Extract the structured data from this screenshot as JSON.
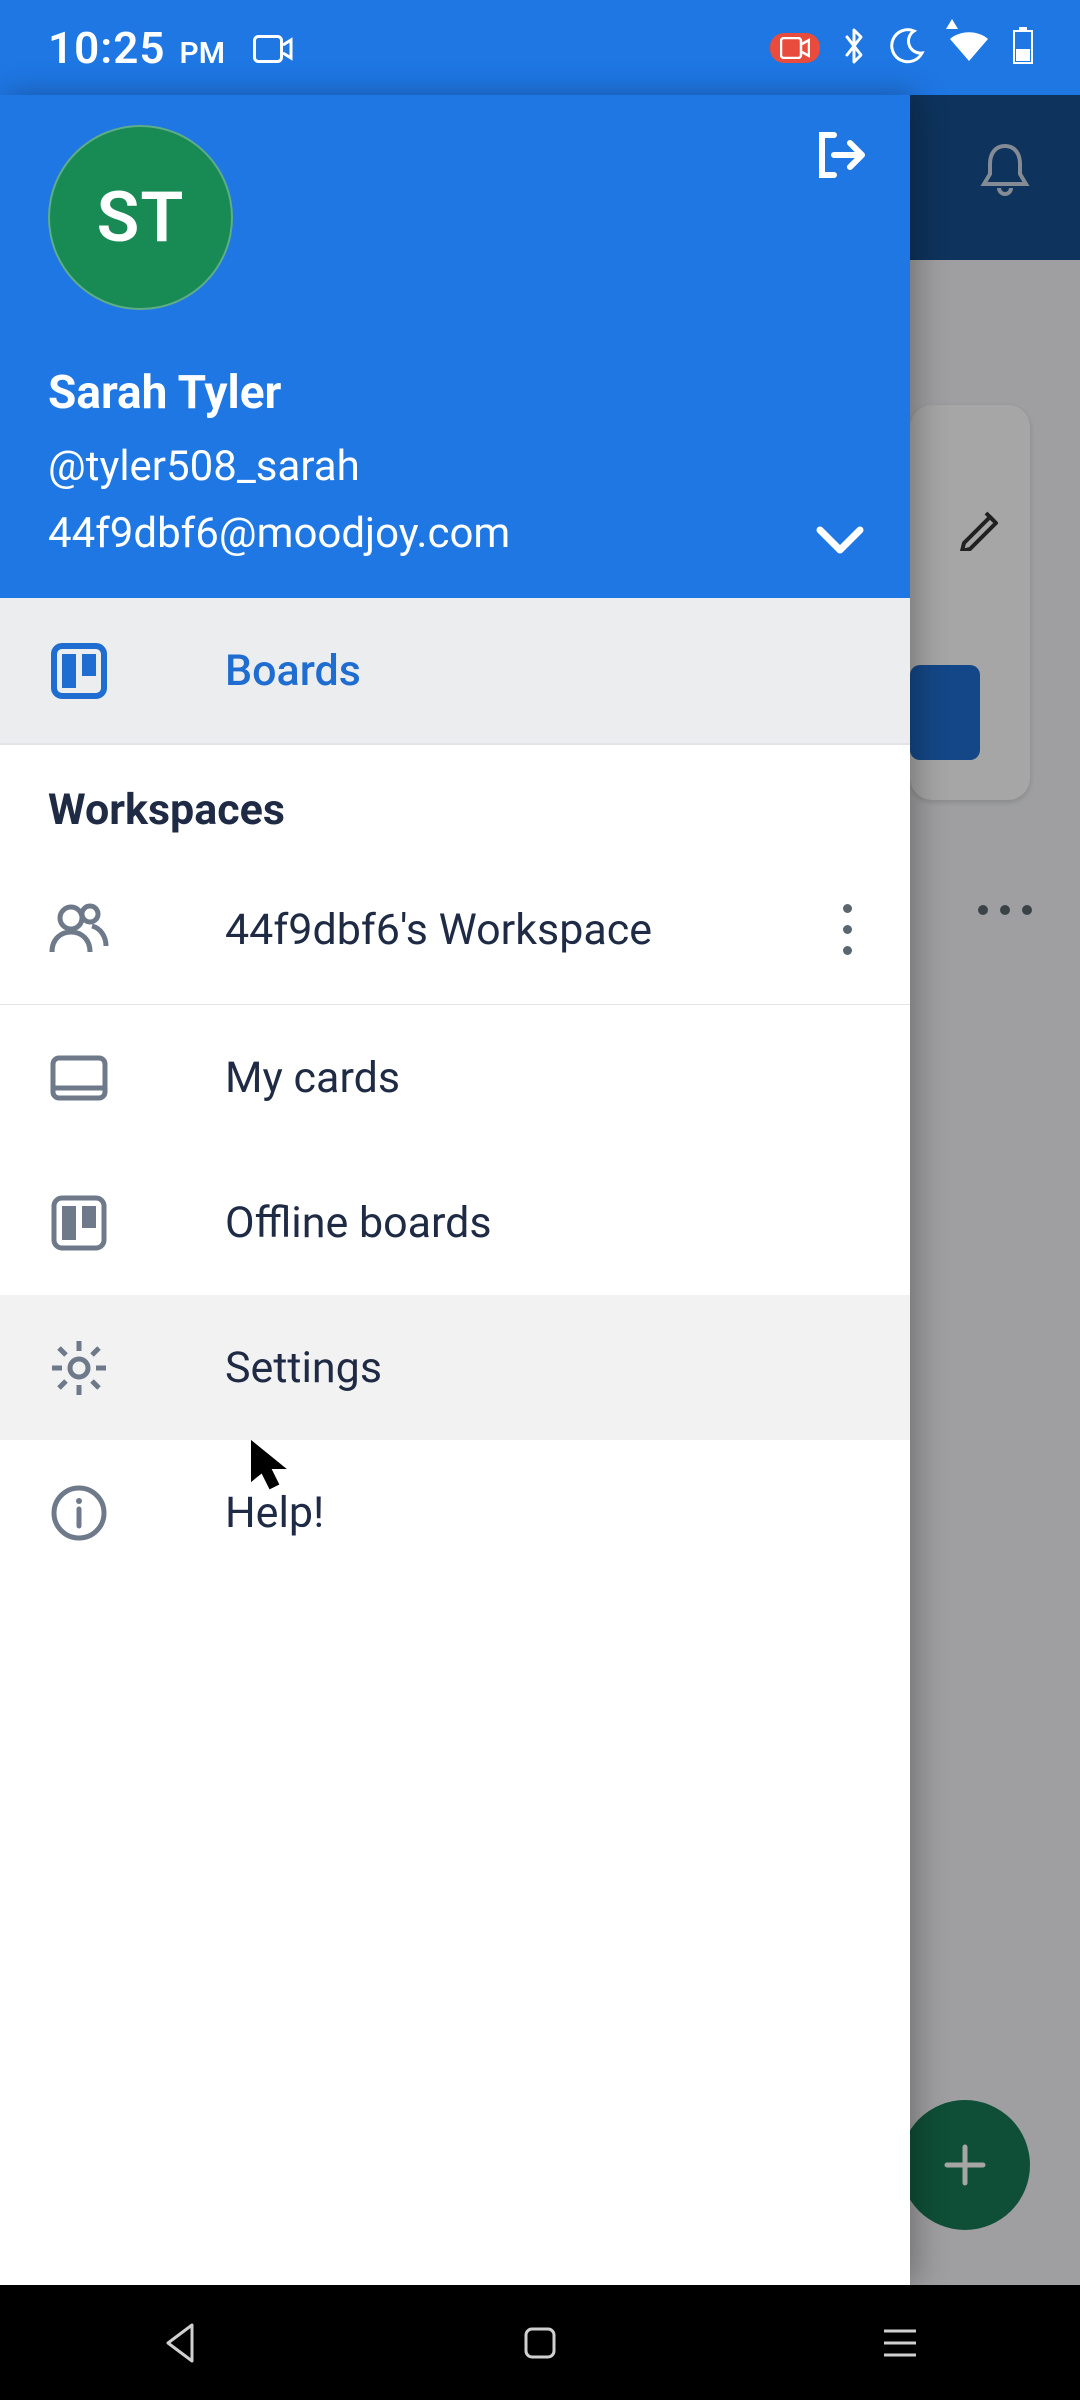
{
  "statusbar": {
    "time": "10:25",
    "ampm": "PM"
  },
  "user": {
    "initials": "ST",
    "name": "Sarah Tyler",
    "handle": "@tyler508_sarah",
    "email": "44f9dbf6@moodjoy.com"
  },
  "menu": {
    "boards": "Boards",
    "section": "Workspaces",
    "workspace": "44f9dbf6's Workspace",
    "mycards": "My cards",
    "offline": "Offline boards",
    "settings": "Settings",
    "help": "Help!"
  }
}
